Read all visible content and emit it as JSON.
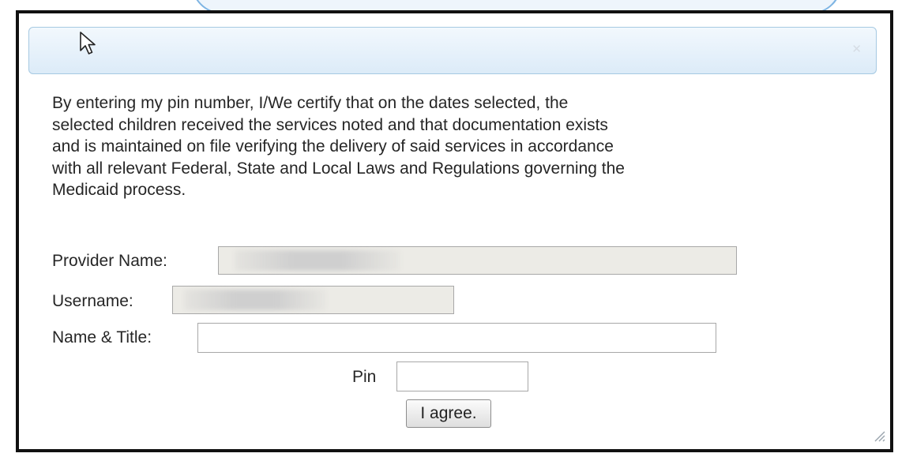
{
  "dialog": {
    "close_icon": "close-icon",
    "resize_icon": "resize-grip-icon",
    "cursor_icon": "mouse-pointer-icon",
    "colors": {
      "titlebar": "#dcebf8",
      "titlebar_border": "#a6c9e2",
      "readonly_field": "#ecebe6",
      "frame": "#111111"
    }
  },
  "certification_text": "By entering my pin number, I/We certify that on the dates selected, the\nselected children received the services noted and that documentation exists\nand is maintained on file verifying the delivery of said services in accordance\nwith all relevant Federal, State and Local Laws and Regulations governing the\nMedicaid process.",
  "form": {
    "provider_name": {
      "label": "Provider Name:",
      "value": ""
    },
    "username": {
      "label": "Username:",
      "value": ""
    },
    "name_title": {
      "label": "Name & Title:",
      "value": ""
    },
    "pin": {
      "label": "Pin",
      "value": ""
    },
    "agree_label": "I agree."
  }
}
